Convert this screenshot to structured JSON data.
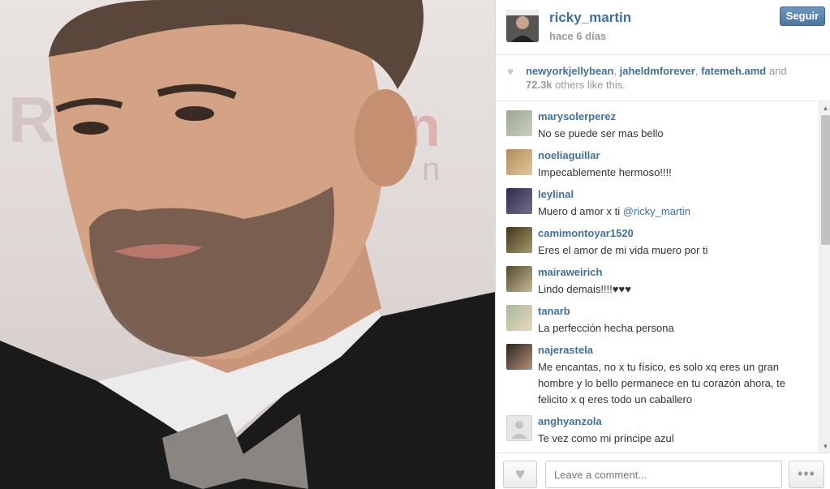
{
  "post": {
    "username": "ricky_martin",
    "time_ago": "hace 6 días",
    "follow_label": "Seguir"
  },
  "likes": {
    "users": [
      "newyorkjellybean",
      "jaheldmforever",
      "fatemeh.amd"
    ],
    "sep1": ", ",
    "sep2": ", ",
    "and_text": " and",
    "count": "72.3k",
    "suffix": " others like this."
  },
  "comments": [
    {
      "user": "marysolerperez",
      "text": "No se puede ser mas bello"
    },
    {
      "user": "noeliaguillar",
      "text": "Impecablemente hermoso!!!!"
    },
    {
      "user": "leylinal",
      "text": "Muero d amor x ti ",
      "mention": "@ricky_martin"
    },
    {
      "user": "camimontoyar1520",
      "text": "Eres el amor de mi vida muero por ti"
    },
    {
      "user": "mairaweirich",
      "text": "Lindo demais!!!!♥♥♥"
    },
    {
      "user": "tanarb",
      "text": "La perfección hecha persona"
    },
    {
      "user": "najerastela",
      "text": "Me encantas, no x tu físico, es solo xq eres un gran hombre y lo bello permanece en tu corazón ahora, te felicito x q eres todo un caballero"
    },
    {
      "user": "anghyanzola",
      "text": "Te vez como mi príncipe azul"
    }
  ],
  "footer": {
    "comment_placeholder": "Leave a comment...",
    "more_label": "•••"
  },
  "icons": {
    "like": "heart-icon",
    "more": "more-icon",
    "scroll_up": "arrow-up-icon",
    "scroll_down": "arrow-down-icon"
  },
  "colors": {
    "link": "#3f729b",
    "follow_button": "#4d77a0",
    "muted": "#999999"
  }
}
